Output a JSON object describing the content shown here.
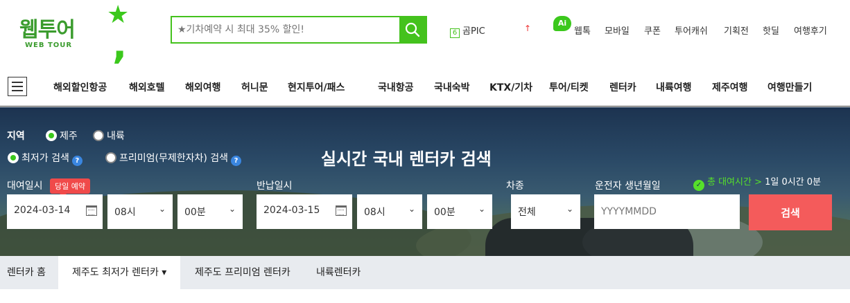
{
  "logo": {
    "wordmark": "웹투어",
    "sub": "WEB TOUR"
  },
  "search": {
    "placeholder": "★기차예약 시 최대 35% 할인!"
  },
  "util_links": {
    "gompic": "곰PIC",
    "gompic_badge": "6",
    "up_arrow": "↑",
    "ai_badge": "Ai",
    "items": [
      "웹톡",
      "모바일",
      "쿠폰",
      "투어캐쉬",
      "기획전",
      "핫딜",
      "여행후기"
    ]
  },
  "nav": {
    "items": [
      "해외할인항공",
      "해외호텔",
      "해외여행",
      "허니문",
      "현지투어/패스",
      "국내항공",
      "국내숙박",
      "KTX/기차",
      "투어/티켓",
      "렌터카",
      "내륙여행",
      "제주여행",
      "여행만들기"
    ]
  },
  "hero": {
    "title": "실시간 국내 렌터카 검색",
    "region_label": "지역",
    "region_options": [
      "제주",
      "내륙"
    ],
    "search_options": [
      "최저가 검색",
      "프리미엄(무제한자차) 검색"
    ],
    "help": "?",
    "rent_label": "대여일시",
    "today_tag": "당일 예약",
    "return_label": "반납일시",
    "car_type_label": "차종",
    "driver_label": "운전자 생년월일",
    "rent_date": "2024-03-14",
    "rent_hour": "08시",
    "rent_min": "00분",
    "return_date": "2024-03-15",
    "return_hour": "08시",
    "return_min": "00분",
    "car_type": "전체",
    "birth_placeholder": "YYYYMMDD",
    "search_button": "검색",
    "total_time_label": "총 대여시간 >",
    "total_time_value": "1일 0시간 0분",
    "check_icon": "✓",
    "chevron": "⌄"
  },
  "tabs": [
    "렌터카 홈",
    "제주도 최저가 렌터카 ▾",
    "제주도 프리미엄 렌터카",
    "내륙렌터카"
  ]
}
